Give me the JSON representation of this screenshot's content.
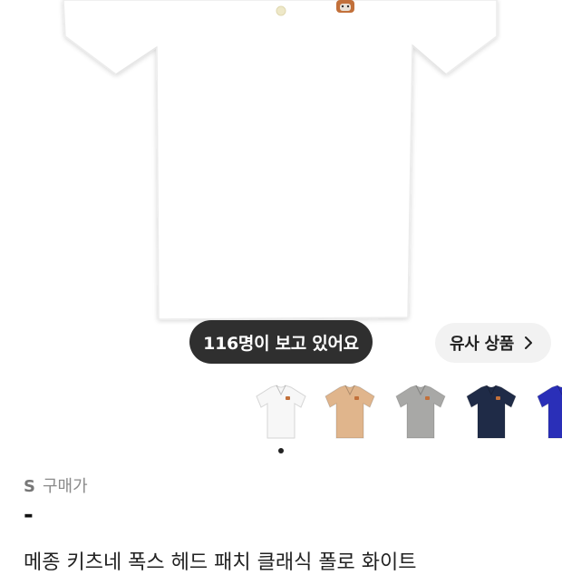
{
  "viewers_badge": "116명이 보고 있어요",
  "similar_button": {
    "label": "유사 상품"
  },
  "color_options": [
    {
      "name": "white-polo",
      "color": "#f7f7f7"
    },
    {
      "name": "beige-polo",
      "color": "#e0b58c"
    },
    {
      "name": "grey-polo",
      "color": "#a8a8a6"
    },
    {
      "name": "navy-polo",
      "color": "#1f2b47"
    },
    {
      "name": "blue-polo",
      "color": "#2a2fb8"
    }
  ],
  "size": "S",
  "price_label": "구매가",
  "price_value": "-",
  "product_name": "메종 키츠네 폭스 헤드 패치 클래식 폴로 화이트",
  "colors": {
    "hero_shirt": "#ffffff",
    "pill_bg": "#2f2f2f",
    "button_bg": "#f2f2f2"
  }
}
